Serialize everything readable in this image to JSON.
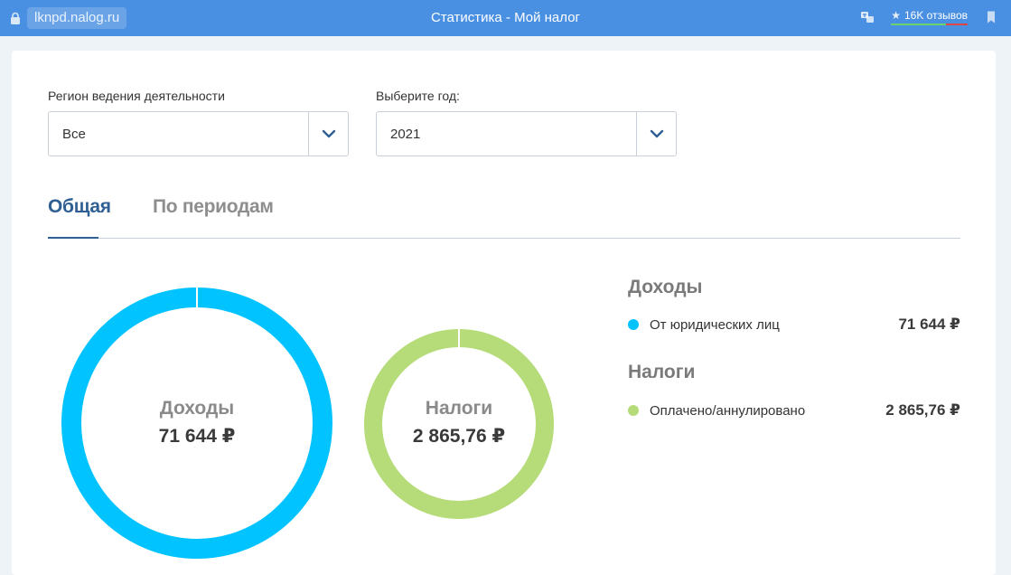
{
  "browser": {
    "url": "lknpd.nalog.ru",
    "title": "Статистика - Мой налог",
    "reviews": "16K отзывов"
  },
  "filters": {
    "region": {
      "label": "Регион ведения деятельности",
      "value": "Все"
    },
    "year": {
      "label": "Выберите год:",
      "value": "2021"
    }
  },
  "tabs": [
    {
      "label": "Общая",
      "active": true
    },
    {
      "label": "По периодам",
      "active": false
    }
  ],
  "summary": {
    "income": {
      "title": "Доходы",
      "value": "71 644 ₽",
      "color": "#00c3ff",
      "fraction": 1.0
    },
    "taxes": {
      "title": "Налоги",
      "value": "2 865,76 ₽",
      "color": "#b5dc78",
      "fraction": 1.0
    }
  },
  "legend": {
    "income_heading": "Доходы",
    "income_items": [
      {
        "label": "От юридических лиц",
        "value": "71 644 ₽",
        "color": "#00c3ff"
      }
    ],
    "taxes_heading": "Налоги",
    "taxes_items": [
      {
        "label": "Оплачено/аннулировано",
        "value": "2 865,76 ₽",
        "color": "#b5dc78"
      }
    ]
  }
}
